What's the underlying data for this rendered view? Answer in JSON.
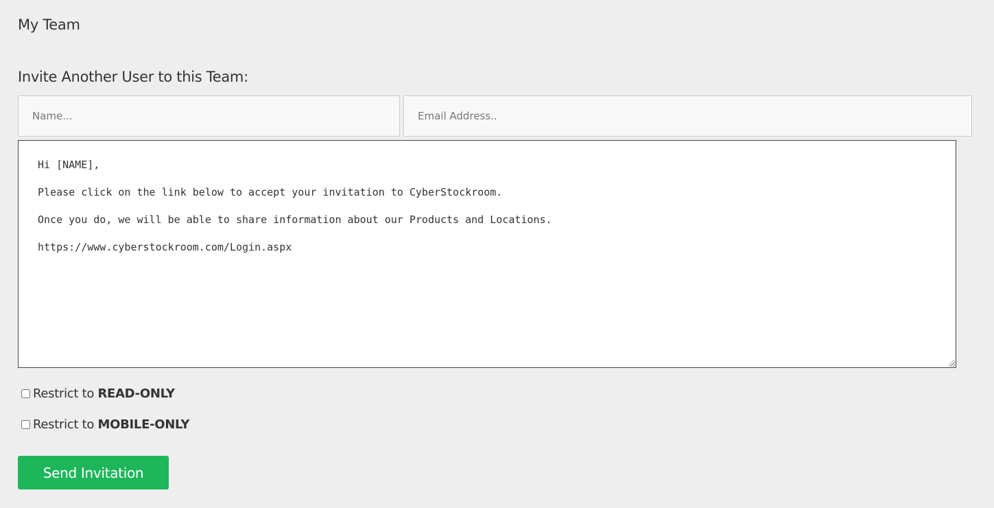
{
  "page": {
    "title": "My Team"
  },
  "invite": {
    "heading": "Invite Another User to this Team:",
    "name_placeholder": "Name...",
    "email_placeholder": "Email Address..",
    "message_lines": [
      "Hi [NAME],",
      "Please click on the link below to accept your invitation to CyberStockroom.",
      "Once you do, we will be able to share information about our Products and Locations.",
      "https://www.cyberstockroom.com/Login.aspx"
    ],
    "options": [
      {
        "prefix": "Restrict to ",
        "emphasis": "READ-ONLY",
        "checked": false
      },
      {
        "prefix": "Restrict to ",
        "emphasis": "MOBILE-ONLY",
        "checked": false
      }
    ],
    "send_label": "Send Invitation"
  },
  "colors": {
    "background": "#eeeeee",
    "button": "#1db65a",
    "button_text": "#ffffff"
  }
}
